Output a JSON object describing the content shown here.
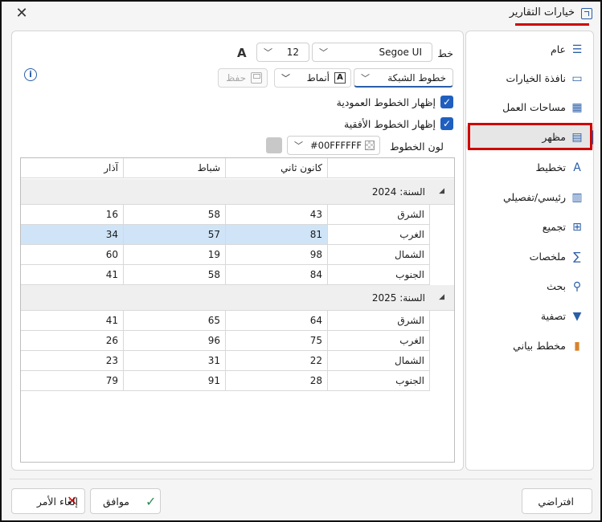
{
  "title": "خيارات التقارير",
  "nav": {
    "items": [
      {
        "label": "عام",
        "icon": "list-settings-icon"
      },
      {
        "label": "نافذة الخيارات",
        "icon": "window-icon"
      },
      {
        "label": "مساحات العمل",
        "icon": "workspace-icon"
      },
      {
        "label": "مظهر",
        "icon": "appearance-icon"
      },
      {
        "label": "تخطيط",
        "icon": "layout-icon"
      },
      {
        "label": "رئيسي/تفصيلي",
        "icon": "master-detail-icon"
      },
      {
        "label": "تجميع",
        "icon": "grouping-icon"
      },
      {
        "label": "ملخصات",
        "icon": "sigma-icon"
      },
      {
        "label": "بحث",
        "icon": "search-icon"
      },
      {
        "label": "تصفية",
        "icon": "filter-icon"
      },
      {
        "label": "مخطط بياني",
        "icon": "chart-icon"
      }
    ]
  },
  "appearance": {
    "font_label": "خط",
    "font_family": "Segoe UI",
    "font_size": "12",
    "font_icon_glyph": "A",
    "grid_lines": "خطوط الشبكة",
    "styles": "أنماط",
    "save": "حفظ",
    "show_vertical": "إظهار الخطوط العمودية",
    "show_horizontal": "إظهار الخطوط الأفقية",
    "line_color_label": "لون الخطوط",
    "line_color_value": "#00FFFFFF"
  },
  "table": {
    "columns": [
      "",
      "كانون ثاني",
      "شباط",
      "آذار"
    ],
    "groups": [
      {
        "label": "السنة: 2024",
        "rows": [
          {
            "region": "الشرق",
            "jan": "43",
            "feb": "58",
            "mar": "16"
          },
          {
            "region": "الغرب",
            "jan": "81",
            "feb": "57",
            "mar": "34"
          },
          {
            "region": "الشمال",
            "jan": "98",
            "feb": "19",
            "mar": "60"
          },
          {
            "region": "الجنوب",
            "jan": "84",
            "feb": "58",
            "mar": "41"
          }
        ]
      },
      {
        "label": "السنة: 2025",
        "rows": [
          {
            "region": "الشرق",
            "jan": "64",
            "feb": "65",
            "mar": "41"
          },
          {
            "region": "الغرب",
            "jan": "75",
            "feb": "96",
            "mar": "26"
          },
          {
            "region": "الشمال",
            "jan": "22",
            "feb": "31",
            "mar": "23"
          },
          {
            "region": "الجنوب",
            "jan": "28",
            "feb": "91",
            "mar": "79"
          }
        ]
      }
    ]
  },
  "footer": {
    "default": "افتراضي",
    "ok": "موافق",
    "cancel": "إلغاء الأمر"
  },
  "colors": {
    "accent": "#2a5ea8",
    "highlight": "#d00000",
    "selection": "#cfe4f7"
  }
}
